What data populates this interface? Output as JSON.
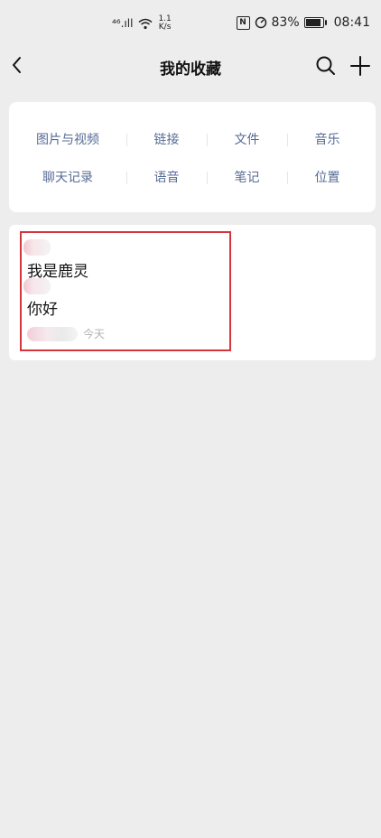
{
  "status_bar": {
    "signal_text": "⁴⁶.ıll",
    "net_speed_value": "1.1",
    "net_speed_unit": "K/s",
    "nfc": "N",
    "battery_percent": "83%",
    "battery_level": 0.83,
    "time": "08:41"
  },
  "nav": {
    "title": "我的收藏"
  },
  "categories": {
    "row1": [
      "图片与视频",
      "链接",
      "文件",
      "音乐"
    ],
    "row2": [
      "聊天记录",
      "语音",
      "笔记",
      "位置"
    ]
  },
  "favorite": {
    "line1": "我是鹿灵",
    "line2": "你好",
    "date": "今天"
  },
  "colors": {
    "accent_link": "#576b95",
    "highlight": "#d6363b",
    "background": "#ededed"
  }
}
